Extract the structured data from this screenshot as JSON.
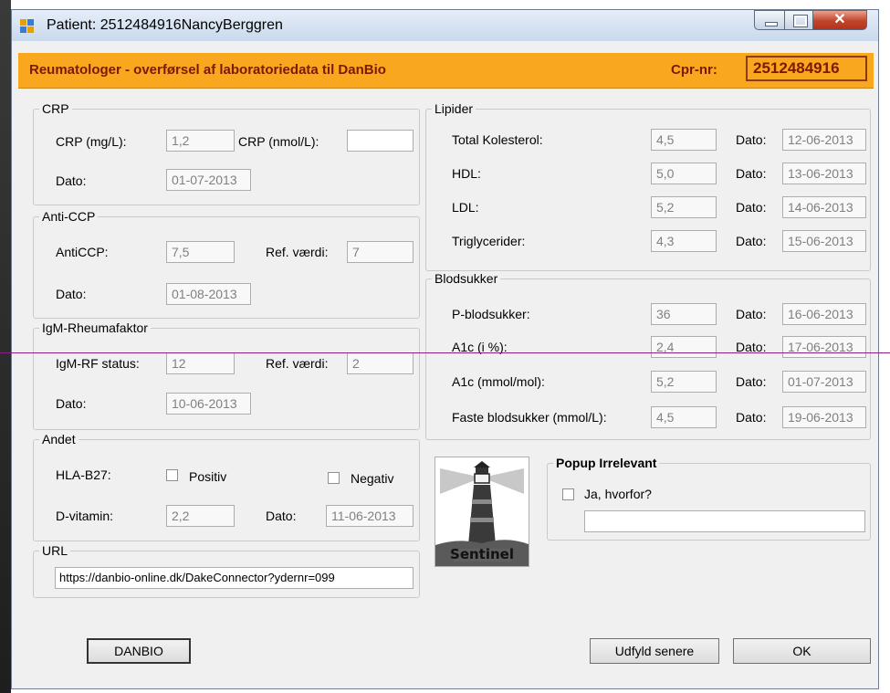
{
  "window": {
    "title": "Patient: 2512484916NancyBerggren"
  },
  "banner": {
    "title": "Reumatologer - overførsel af laboratoriedata til DanBio",
    "cpr_label": "Cpr-nr:",
    "cpr_value": "2512484916"
  },
  "crp": {
    "group": "CRP",
    "mg_label": "CRP (mg/L):",
    "mg_value": "1,2",
    "nmol_label": "CRP (nmol/L):",
    "nmol_value": "",
    "date_label": "Dato:",
    "date_value": "01-07-2013"
  },
  "anticcp": {
    "group": "Anti-CCP",
    "label": "AntiCCP:",
    "value": "7,5",
    "ref_label": "Ref. værdi:",
    "ref_value": "7",
    "date_label": "Dato:",
    "date_value": "01-08-2013"
  },
  "igm": {
    "group": "IgM-Rheumafaktor",
    "status_label": "IgM-RF status:",
    "status_value": "12",
    "ref_label": "Ref. værdi:",
    "ref_value": "2",
    "date_label": "Dato:",
    "date_value": "10-06-2013"
  },
  "andet": {
    "group": "Andet",
    "hla_label": "HLA-B27:",
    "positiv_label": "Positiv",
    "negativ_label": "Negativ",
    "dvit_label": "D-vitamin:",
    "dvit_value": "2,2",
    "date_label": "Dato:",
    "date_value": "11-06-2013"
  },
  "url": {
    "group": "URL",
    "value": "https://danbio-online.dk/DakeConnector?ydernr=099"
  },
  "lipider": {
    "group": "Lipider",
    "rows": [
      {
        "label": "Total Kolesterol:",
        "value": "4,5",
        "date_label": "Dato:",
        "date": "12-06-2013"
      },
      {
        "label": "HDL:",
        "value": "5,0",
        "date_label": "Dato:",
        "date": "13-06-2013"
      },
      {
        "label": "LDL:",
        "value": "5,2",
        "date_label": "Dato:",
        "date": "14-06-2013"
      },
      {
        "label": "Triglycerider:",
        "value": "4,3",
        "date_label": "Dato:",
        "date": "15-06-2013"
      }
    ]
  },
  "blodsukker": {
    "group": "Blodsukker",
    "rows": [
      {
        "label": "P-blodsukker:",
        "value": "36",
        "date_label": "Dato:",
        "date": "16-06-2013"
      },
      {
        "label": "A1c (i %):",
        "value": "2,4",
        "date_label": "Dato:",
        "date": "17-06-2013"
      },
      {
        "label": "A1c (mmol/mol):",
        "value": "5,2",
        "date_label": "Dato:",
        "date": "01-07-2013"
      },
      {
        "label": "Faste blodsukker (mmol/L):",
        "value": "4,5",
        "date_label": "Dato:",
        "date": "19-06-2013"
      }
    ]
  },
  "logo": {
    "text": "Sentinel"
  },
  "popup": {
    "group": "Popup Irrelevant",
    "checkbox_label": "Ja, hvorfor?",
    "reason_value": ""
  },
  "buttons": {
    "danbio": "DANBIO",
    "later": "Udfyld senere",
    "ok": "OK"
  },
  "colors": {
    "banner": "#f9a71e",
    "banner_text": "#7a1a00",
    "close_button": "#c0452c"
  },
  "icons": [
    "app-icon",
    "minimize-icon",
    "maximize-icon",
    "close-icon",
    "sentinel-lighthouse-logo"
  ]
}
